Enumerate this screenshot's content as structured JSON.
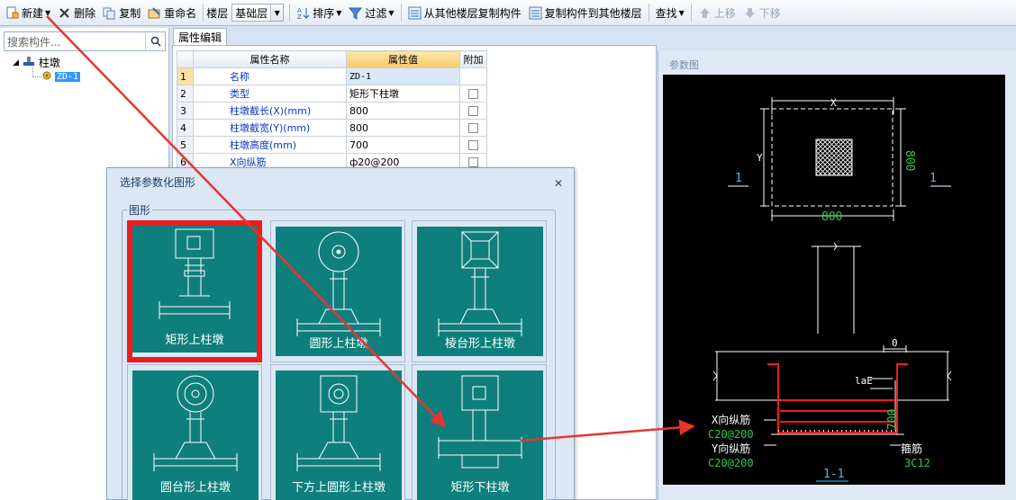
{
  "toolbar": {
    "new": "新建",
    "delete": "删除",
    "copy": "复制",
    "rename": "重命名",
    "floor_label": "楼层",
    "floor_value": "基础层",
    "sort": "排序",
    "filter": "过滤",
    "copy_from_floor": "从其他楼层复制构件",
    "copy_to_floor": "复制构件到其他楼层",
    "find": "查找",
    "move_up": "上移",
    "move_down": "下移"
  },
  "tree": {
    "search_placeholder": "搜索构件...",
    "root_label": "柱墩",
    "child_label": "ZD-1"
  },
  "prop_editor": {
    "tab": "属性编辑",
    "headers": {
      "name": "属性名称",
      "value": "属性值",
      "extra": "附加"
    },
    "rows": [
      {
        "num": "1",
        "name": "名称",
        "value": "ZD-1",
        "check": false
      },
      {
        "num": "2",
        "name": "类型",
        "value": "矩形下柱墩",
        "check": true
      },
      {
        "num": "3",
        "name": "柱墩截长(X)(mm)",
        "value": "800",
        "check": true
      },
      {
        "num": "4",
        "name": "柱墩截宽(Y)(mm)",
        "value": "800",
        "check": true
      },
      {
        "num": "5",
        "name": "柱墩高度(mm)",
        "value": "700",
        "check": true
      },
      {
        "num": "6",
        "name": "X向纵筋",
        "value": "ф20@200",
        "check": true
      }
    ]
  },
  "param_panel": {
    "title": "参数图",
    "drawing": {
      "x_label": "X",
      "y_label": "Y",
      "dim_800_h": "800",
      "dim_800_v": "800",
      "section_left": "1",
      "section_right": "1",
      "dim_0": "0",
      "lae": "laE",
      "dim_700": "700",
      "x_rebar_label": "X向纵筋",
      "x_rebar_value": "C20@200",
      "y_rebar_label": "Y向纵筋",
      "y_rebar_value": "C20@200",
      "stirrup_label": "箍筋",
      "stirrup_value": "3C12",
      "section_title": "1-1"
    }
  },
  "dialog": {
    "title": "选择参数化图形",
    "group": "图形",
    "tiles": [
      {
        "label": "矩形上柱墩",
        "selected": true
      },
      {
        "label": "圆形上柱墩",
        "selected": false
      },
      {
        "label": "棱台形上柱墩",
        "selected": false
      },
      {
        "label": "圆台形上柱墩",
        "selected": false
      },
      {
        "label": "下方上圆形上柱墩",
        "selected": false
      },
      {
        "label": "矩形下柱墩",
        "selected": false
      }
    ]
  },
  "colors": {
    "tile_bg": "#0e7f7d",
    "selection": "#ee1c1c",
    "annotation_arrow": "#e8352f"
  }
}
